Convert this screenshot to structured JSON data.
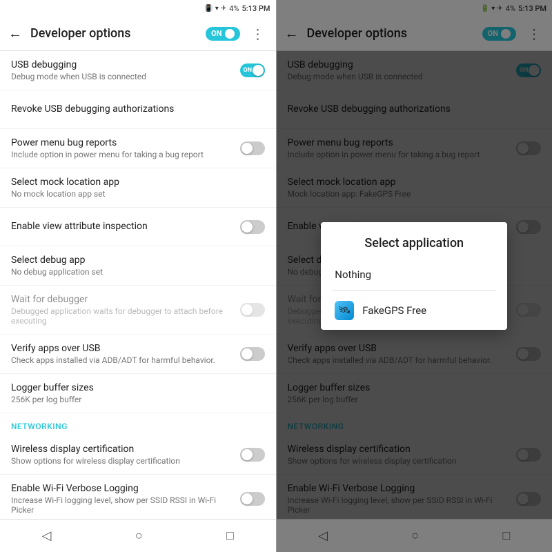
{
  "statusBar": {
    "battery": "4%",
    "time": "5:13 PM"
  },
  "topBar": {
    "title": "Developer options",
    "backLabel": "←",
    "toggleLabel": "ON",
    "moreLabel": "⋮"
  },
  "settings": [
    {
      "id": "usb-debugging",
      "title": "USB debugging",
      "subtitle": "Debug mode when USB is connected",
      "toggle": "on"
    },
    {
      "id": "revoke-usb",
      "title": "Revoke USB debugging authorizations",
      "subtitle": "",
      "toggle": null
    },
    {
      "id": "power-menu-bug",
      "title": "Power menu bug reports",
      "subtitle": "Include option in power menu for taking a bug report",
      "toggle": "off"
    },
    {
      "id": "mock-location",
      "title": "Select mock location app",
      "subtitle": "No mock location app set",
      "toggle": null
    },
    {
      "id": "view-attribute",
      "title": "Enable view attribute inspection",
      "subtitle": "",
      "toggle": "off"
    },
    {
      "id": "debug-app",
      "title": "Select debug app",
      "subtitle": "No debug application set",
      "toggle": null
    },
    {
      "id": "wait-debugger",
      "title": "Wait for debugger",
      "subtitle": "Debugged application waits for debugger to attach before executing",
      "toggle": "off",
      "disabled": true
    },
    {
      "id": "verify-apps",
      "title": "Verify apps over USB",
      "subtitle": "Check apps installed via ADB/ADT for harmful behavior.",
      "toggle": "off"
    },
    {
      "id": "logger-buffer",
      "title": "Logger buffer sizes",
      "subtitle": "256K per log buffer",
      "toggle": null
    }
  ],
  "rightSettings": [
    {
      "id": "usb-debugging",
      "title": "USB debugging",
      "subtitle": "Debug mode when USB is connected",
      "toggle": "on"
    },
    {
      "id": "revoke-usb",
      "title": "Revoke USB debugging authorizations",
      "subtitle": "",
      "toggle": null
    },
    {
      "id": "power-menu-bug",
      "title": "Power menu bug reports",
      "subtitle": "Include option in power menu for taking a bug report",
      "toggle": "off"
    },
    {
      "id": "mock-location",
      "title": "Select mock location app",
      "subtitle": "Mock location app: FakeGPS Free",
      "toggle": null
    },
    {
      "id": "view-attribute",
      "title": "Enable view attribute inspection",
      "subtitle": "",
      "toggle": "off"
    },
    {
      "id": "debug-app",
      "title": "Select debug app",
      "subtitle": "No debug application set",
      "toggle": null
    },
    {
      "id": "wait-debugger",
      "title": "Wait for debugger",
      "subtitle": "Debugged application waits for debugger to attach before executing",
      "toggle": "off",
      "disabled": true
    },
    {
      "id": "verify-apps",
      "title": "Verify apps over USB",
      "subtitle": "Check apps installed via ADB/ADT for harmful behavior.",
      "toggle": "off"
    },
    {
      "id": "logger-buffer",
      "title": "Logger buffer sizes",
      "subtitle": "256K per log buffer",
      "toggle": null
    }
  ],
  "networking": {
    "label": "NETWORKING",
    "items": [
      {
        "id": "wireless-display",
        "title": "Wireless display certification",
        "subtitle": "Show options for wireless display certification",
        "toggle": "off"
      },
      {
        "id": "wifi-verbose",
        "title": "Enable Wi-Fi Verbose Logging",
        "subtitle": "Increase Wi-Fi logging level, show per SSID RSSI in Wi-Fi Picker",
        "toggle": "off"
      }
    ]
  },
  "modal": {
    "title": "Select application",
    "items": [
      {
        "id": "nothing",
        "label": "Nothing",
        "icon": null
      },
      {
        "id": "fakegps",
        "label": "FakeGPS Free",
        "icon": "🛰"
      }
    ]
  },
  "bottomNav": {
    "back": "◁",
    "home": "○",
    "recent": "□"
  }
}
